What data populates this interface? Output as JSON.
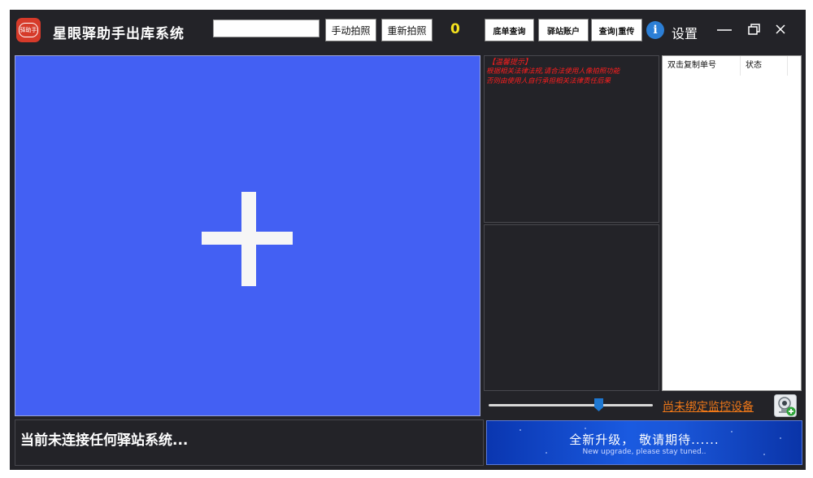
{
  "app": {
    "logo_text": "驿助手",
    "title": "星眼驿助手出库系统"
  },
  "toolbar": {
    "input_value": "",
    "manual_photo_label": "手动拍照",
    "retake_photo_label": "重新拍照",
    "count": "0",
    "bottom_order_query_label": "底单查询",
    "station_account_label": "驿站账户",
    "query_upload_label": "查询|重传",
    "settings_label": "设置"
  },
  "tip": {
    "title": "【温馨提示】",
    "lines": [
      "根据相关法律法规,请合法使用人像拍照功能",
      "否则由使用人自行承担相关法律责任后果"
    ]
  },
  "list": {
    "columns": [
      "双击复制单号",
      "状态"
    ]
  },
  "monitor": {
    "bind_link": "尚未绑定监控设备",
    "slider_level": 0.67
  },
  "status": {
    "text": "当前未连接任何驿站系统..."
  },
  "banner": {
    "main": "全新升级， 敬请期待......",
    "sub": "New upgrade, please stay tuned.."
  },
  "icons": {
    "plus": "plus-icon",
    "info": "info-icon",
    "minimize": "minimize-icon",
    "restore": "restore-icon",
    "close": "close-icon",
    "webcam": "webcam-add-icon"
  },
  "colors": {
    "window_bg": "#232328",
    "camera_bg": "#4360f3",
    "count_yellow": "#f5e21e",
    "tip_red": "#ff1e1e",
    "link_orange": "#f07818",
    "banner_blue": "#1a56d8"
  }
}
